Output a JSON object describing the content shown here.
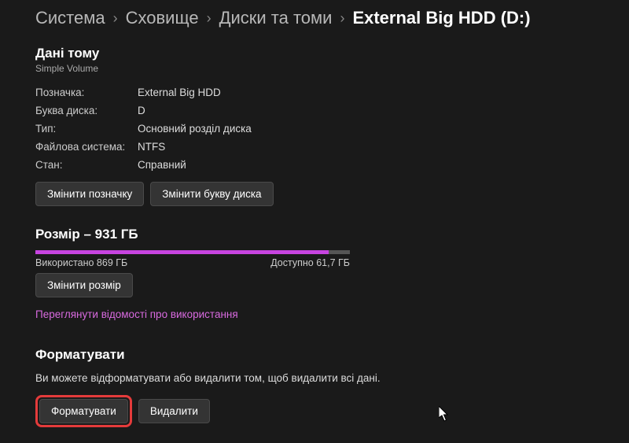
{
  "breadcrumb": {
    "system": "Система",
    "storage": "Сховище",
    "disks": "Диски та томи",
    "current": "External Big HDD (D:)"
  },
  "volume": {
    "heading": "Дані тому",
    "subtitle": "Simple Volume",
    "rows": [
      {
        "key": "Позначка:",
        "val": "External Big HDD"
      },
      {
        "key": "Буква диска:",
        "val": "D"
      },
      {
        "key": "Тип:",
        "val": "Основний розділ диска"
      },
      {
        "key": "Файлова система:",
        "val": "NTFS"
      },
      {
        "key": "Стан:",
        "val": "Справний"
      }
    ],
    "change_label_btn": "Змінити позначку",
    "change_letter_btn": "Змінити букву диска"
  },
  "size": {
    "heading": "Розмір – 931 ГБ",
    "used_label": "Використано 869 ГБ",
    "free_label": "Доступно 61,7 ГБ",
    "used_pct": 93.3,
    "resize_btn": "Змінити розмір",
    "usage_link": "Переглянути відомості про використання"
  },
  "format": {
    "heading": "Форматувати",
    "desc": "Ви можете відформатувати або видалити том, щоб видалити всі дані.",
    "format_btn": "Форматувати",
    "delete_btn": "Видалити"
  }
}
